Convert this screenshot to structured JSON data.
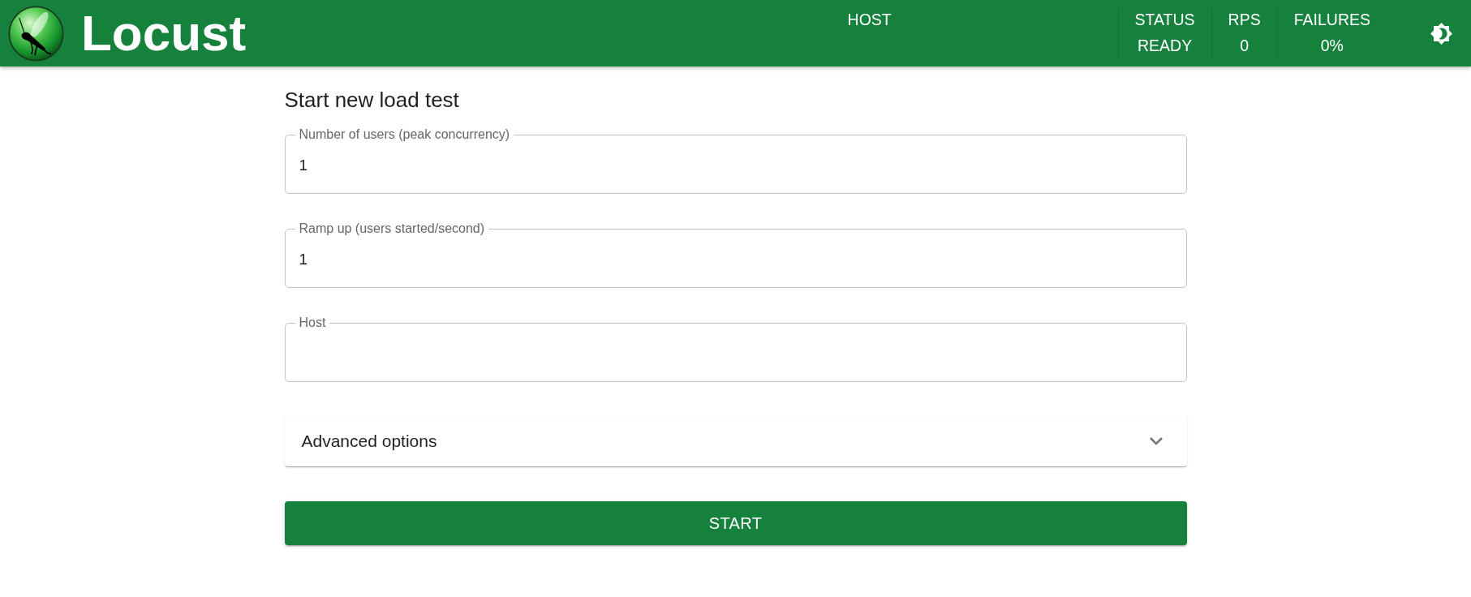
{
  "header": {
    "brand": "Locust",
    "host_label": "HOST",
    "stats": [
      {
        "label": "STATUS",
        "value": "READY"
      },
      {
        "label": "RPS",
        "value": "0"
      },
      {
        "label": "FAILURES",
        "value": "0%"
      }
    ]
  },
  "form": {
    "title": "Start new load test",
    "fields": [
      {
        "label": "Number of users (peak concurrency)",
        "value": "1"
      },
      {
        "label": "Ramp up (users started/second)",
        "value": "1"
      },
      {
        "label": "Host"
      }
    ],
    "advanced": {
      "label": "Advanced options",
      "expanded": false
    },
    "submit": "START"
  }
}
